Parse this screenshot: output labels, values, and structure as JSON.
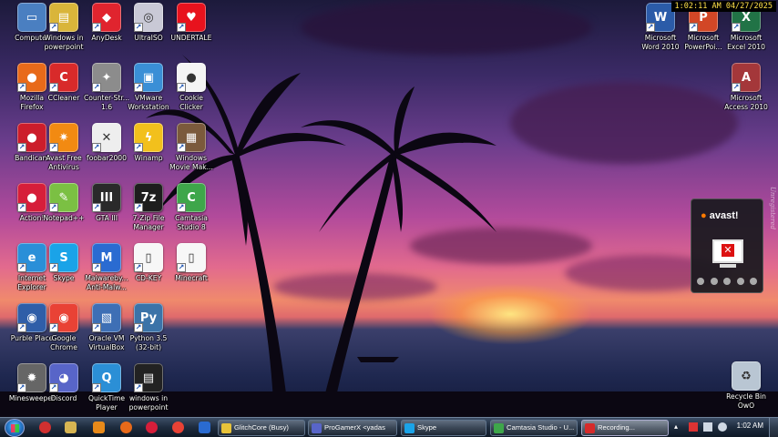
{
  "overlay": {
    "clock": "1:02:11 AM 04/27/2025"
  },
  "desktop_icons": [
    {
      "name": "computer",
      "label": "Computer",
      "color": "#4a7fc1",
      "glyph": "▭"
    },
    {
      "name": "windows-in-powerpoint",
      "label": "Windows in\npowerpoint",
      "color": "#d9b53a",
      "glyph": "▤"
    },
    {
      "name": "anydesk",
      "label": "AnyDesk",
      "color": "#e0242e",
      "glyph": "◆"
    },
    {
      "name": "ultraiso",
      "label": "UltraISO",
      "color": "#c9c9d6",
      "glyph": "◎"
    },
    {
      "name": "undertale",
      "label": "UNDERTALE",
      "color": "#e8121d",
      "glyph": "♥"
    },
    {
      "name": "mozilla-firefox",
      "label": "Mozilla\nFirefox",
      "color": "#e86a1a",
      "glyph": "●"
    },
    {
      "name": "ccleaner",
      "label": "CCleaner",
      "color": "#d82a2a",
      "glyph": "C"
    },
    {
      "name": "counter-strike",
      "label": "Counter-Str...\n1.6",
      "color": "#8c8c8c",
      "glyph": "✦"
    },
    {
      "name": "vmware-workstation",
      "label": "VMware\nWorkstation",
      "color": "#3a8fd6",
      "glyph": "▣"
    },
    {
      "name": "cookie-clicker",
      "label": "Cookie\nClicker",
      "color": "#f4f4f4",
      "glyph": "●"
    },
    {
      "name": "bandicam",
      "label": "Bandicam",
      "color": "#cc1d2b",
      "glyph": "●"
    },
    {
      "name": "avast-free-antivirus",
      "label": "Avast Free\nAntivirus",
      "color": "#f28a12",
      "glyph": "✷"
    },
    {
      "name": "foobar2000",
      "label": "foobar2000",
      "color": "#eeeeee",
      "glyph": "✕"
    },
    {
      "name": "winamp",
      "label": "Winamp",
      "color": "#f2c01c",
      "glyph": "ϟ"
    },
    {
      "name": "windows-movie-maker",
      "label": "Windows\nMovie Mak...",
      "color": "#7b5a3c",
      "glyph": "▦"
    },
    {
      "name": "action",
      "label": "Action!",
      "color": "#d61e3a",
      "glyph": "●"
    },
    {
      "name": "notepad-plus-plus",
      "label": "Notepad++",
      "color": "#7bc043",
      "glyph": "✎"
    },
    {
      "name": "gta-iii",
      "label": "GTA III",
      "color": "#2a2a2a",
      "glyph": "III"
    },
    {
      "name": "7-zip-file-manager",
      "label": "7-Zip File\nManager",
      "color": "#1d1d1d",
      "glyph": "7z"
    },
    {
      "name": "camtasia-studio-8",
      "label": "Camtasia\nStudio 8",
      "color": "#3ea64a",
      "glyph": "C"
    },
    {
      "name": "internet-explorer",
      "label": "Internet\nExplorer",
      "color": "#2a8fd8",
      "glyph": "e"
    },
    {
      "name": "skype",
      "label": "Skype",
      "color": "#1aa3e8",
      "glyph": "S"
    },
    {
      "name": "malwarebytes",
      "label": "Malwareby...\nAnti-Malw...",
      "color": "#2a6bd1",
      "glyph": "M"
    },
    {
      "name": "cd-key",
      "label": "CD-KEY",
      "color": "#f7f7f7",
      "glyph": "▯"
    },
    {
      "name": "minecraft",
      "label": "Minecraft",
      "color": "#f7f7f7",
      "glyph": "▯"
    },
    {
      "name": "purble-place",
      "label": "Purble Place",
      "color": "#2f5ea8",
      "glyph": "◉"
    },
    {
      "name": "google-chrome",
      "label": "Google\nChrome",
      "color": "#e94235",
      "glyph": "◉"
    },
    {
      "name": "oracle-vm-virtualbox",
      "label": "Oracle VM\nVirtualBox",
      "color": "#3e6fb5",
      "glyph": "▧"
    },
    {
      "name": "python-3-5",
      "label": "Python 3.5\n(32-bit)",
      "color": "#3b73a8",
      "glyph": "Py"
    },
    {
      "name": "minesweeper",
      "label": "Minesweeper",
      "color": "#666666",
      "glyph": "✹"
    },
    {
      "name": "discord",
      "label": "Discord",
      "color": "#5865c8",
      "glyph": "◕"
    },
    {
      "name": "quicktime-player",
      "label": "QuickTime\nPlayer",
      "color": "#2b8fd6",
      "glyph": "Q"
    },
    {
      "name": "windows-in-powerpoint-2",
      "label": "windows in\npowerpoint",
      "color": "#222222",
      "glyph": "▤"
    },
    {
      "name": "microsoft-word-2010",
      "label": "Microsoft\nWord 2010",
      "color": "#2b5ba8",
      "glyph": "W"
    },
    {
      "name": "microsoft-powerpoint",
      "label": "Microsoft\nPowerPoi...",
      "color": "#d24726",
      "glyph": "P"
    },
    {
      "name": "microsoft-excel-2010",
      "label": "Microsoft\nExcel 2010",
      "color": "#217346",
      "glyph": "X"
    },
    {
      "name": "microsoft-access-2010",
      "label": "Microsoft\nAccess 2010",
      "color": "#a4373a",
      "glyph": "A"
    },
    {
      "name": "recycle-bin",
      "label": "Recycle Bin\nOwO",
      "color": "#b9c6d3",
      "glyph": "♻"
    }
  ],
  "avast_widget": {
    "brand_pre": "",
    "brand": "avast!"
  },
  "watermark": {
    "text": "Unregistered"
  },
  "taskbar": {
    "tasks": [
      {
        "label": "GlitchCore (Busy)",
        "color": "#e8c33a"
      },
      {
        "label": "ProGamerX <yadas",
        "color": "#5865c8"
      },
      {
        "label": "Skype",
        "color": "#1aa3e8"
      },
      {
        "label": "Camtasia Studio - U...",
        "color": "#3ea64a"
      },
      {
        "label": "Recording...",
        "color": "#d62a2a"
      }
    ],
    "time": "1:02 AM"
  }
}
